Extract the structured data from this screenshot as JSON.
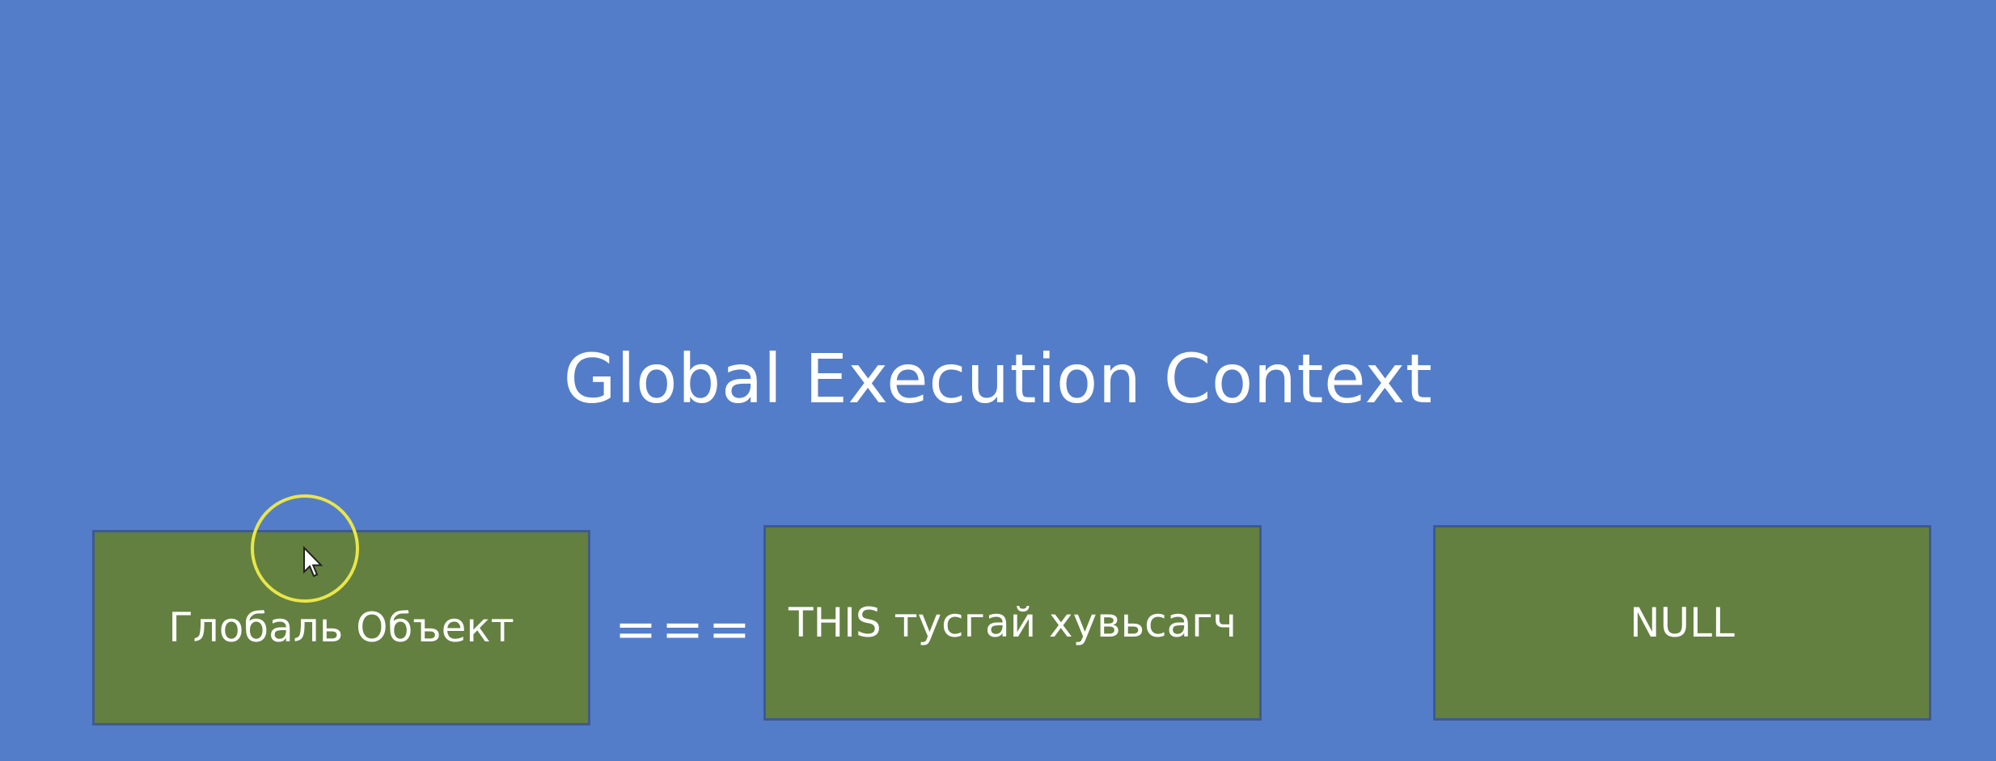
{
  "slide": {
    "title": "Global Execution Context",
    "boxes": [
      {
        "label": "Глобаль Объект"
      },
      {
        "label": "THIS тусгай хувьсагч"
      },
      {
        "label": "NULL"
      }
    ],
    "operator": "===",
    "box_fill": "#638040",
    "background": "#547dc9",
    "cursor_highlight_color": "#e9e64a",
    "cursor_icon": "arrow-pointer-icon"
  }
}
